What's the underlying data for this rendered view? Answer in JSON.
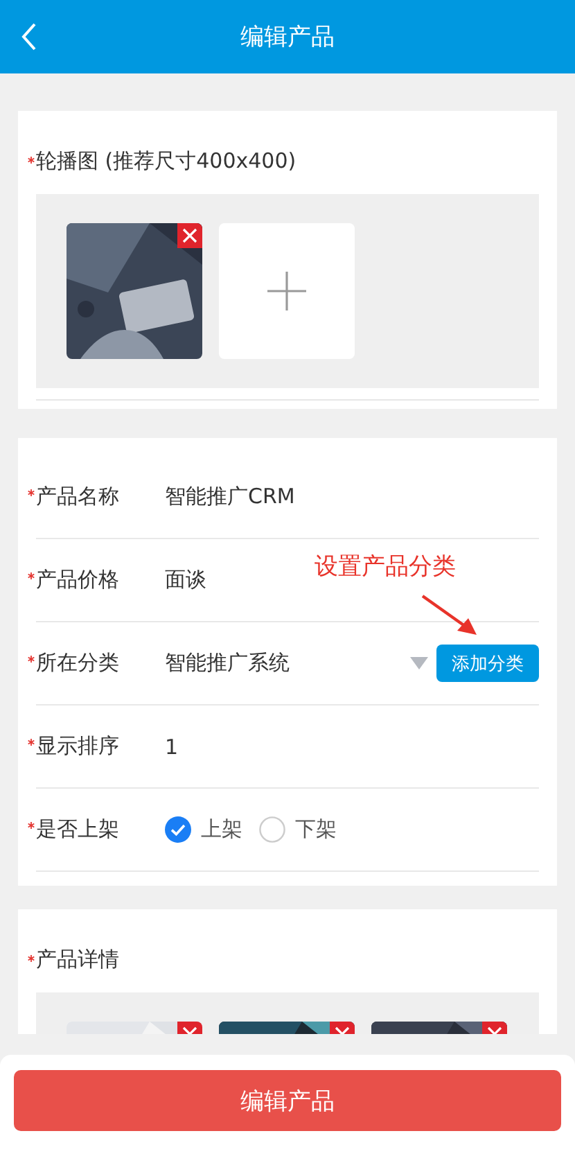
{
  "header": {
    "title": "编辑产品"
  },
  "carousel": {
    "label": "轮播图 (推荐尺寸400x400)",
    "required": true
  },
  "fields": [
    {
      "kind": "text",
      "label": "产品名称",
      "required": true,
      "value": "智能推广CRM"
    },
    {
      "kind": "text",
      "label": "产品价格",
      "required": true,
      "value": "面谈"
    },
    {
      "kind": "select",
      "label": "所在分类",
      "required": true,
      "value": "智能推广系统",
      "button": "添加分类"
    },
    {
      "kind": "text",
      "label": "显示排序",
      "required": true,
      "value": "1"
    },
    {
      "kind": "radio",
      "label": "是否上架",
      "required": true,
      "options": [
        {
          "label": "上架",
          "selected": true
        },
        {
          "label": "下架",
          "selected": false
        }
      ]
    }
  ],
  "annotation": {
    "text": "设置产品分类"
  },
  "details": {
    "label": "产品详情",
    "required": true
  },
  "submit_button": "编辑产品"
}
